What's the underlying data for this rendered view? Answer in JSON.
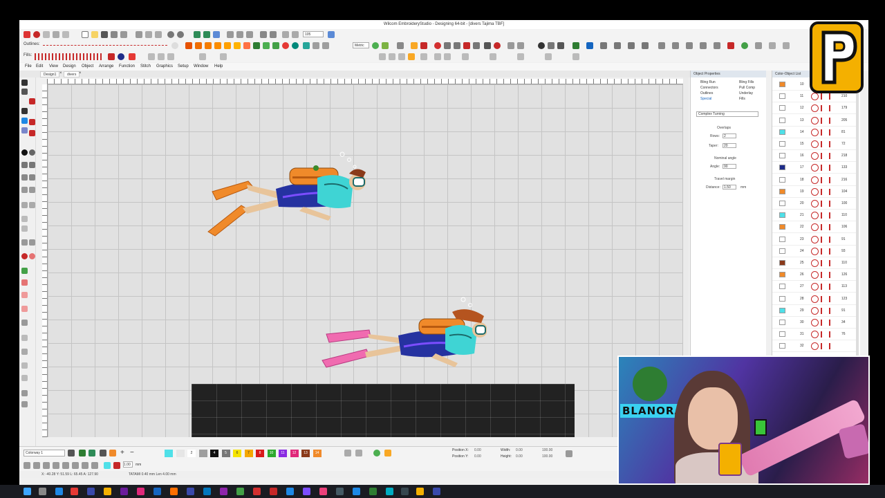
{
  "window": {
    "title": "Wilcom EmbroideryStudio - Designing 64-bit - [divers      Tajima TBF]"
  },
  "toolbar": {
    "outlines_label": "Outlines:",
    "fills_label": "Fills:",
    "zoom_value": "105",
    "units_value": "Metric"
  },
  "menu": [
    "File",
    "Edit",
    "View",
    "Design",
    "Object",
    "Arrange",
    "Function",
    "Stitch",
    "Graphics",
    "Setup",
    "Window",
    "Help"
  ],
  "doc_tabs": [
    "Design1",
    "divers"
  ],
  "object_properties": {
    "title": "Object Properties",
    "tabs": [
      "Bling Run",
      "Bling Fills",
      "Connectors",
      "Pull Comp",
      "Outlines",
      "Underlay",
      "Special",
      "Fills"
    ],
    "stitch_type": "Complex Turning",
    "overlaps_label": "Overlaps",
    "rows_label": "Rows:",
    "rows_value": "2",
    "taper_label": "Taper:",
    "taper_value": "20",
    "nominal_angle_label": "Nominal angle",
    "angle_label": "Angle:",
    "angle_value": "90",
    "travel_margin_label": "Travel margin",
    "distance_label": "Distance:",
    "distance_value": "1.50",
    "distance_unit": "mm"
  },
  "color_object_list": {
    "title": "Color-Object List",
    "rows": [
      {
        "num": "10",
        "count": "",
        "color": "#f08a2a"
      },
      {
        "num": "11",
        "count": "210",
        "color": "#ffffff"
      },
      {
        "num": "12",
        "count": "179",
        "color": "#ffffff"
      },
      {
        "num": "13",
        "count": "205",
        "color": "#ffffff"
      },
      {
        "num": "14",
        "count": "81",
        "color": "#4fe0e8"
      },
      {
        "num": "15",
        "count": "72",
        "color": "#ffffff"
      },
      {
        "num": "16",
        "count": "218",
        "color": "#ffffff"
      },
      {
        "num": "17",
        "count": "133",
        "color": "#1e2c8a"
      },
      {
        "num": "18",
        "count": "216",
        "color": "#ffffff"
      },
      {
        "num": "19",
        "count": "104",
        "color": "#f08a2a"
      },
      {
        "num": "20",
        "count": "100",
        "color": "#ffffff"
      },
      {
        "num": "21",
        "count": "110",
        "color": "#4fe0e8"
      },
      {
        "num": "22",
        "count": "106",
        "color": "#f08a2a"
      },
      {
        "num": "23",
        "count": "91",
        "color": "#ffffff"
      },
      {
        "num": "24",
        "count": "93",
        "color": "#ffffff"
      },
      {
        "num": "25",
        "count": "110",
        "color": "#8a3a1a"
      },
      {
        "num": "26",
        "count": "126",
        "color": "#f08a2a"
      },
      {
        "num": "27",
        "count": "113",
        "color": "#ffffff"
      },
      {
        "num": "28",
        "count": "123",
        "color": "#ffffff"
      },
      {
        "num": "29",
        "count": "91",
        "color": "#4fe0e8"
      },
      {
        "num": "30",
        "count": "34",
        "color": "#ffffff"
      },
      {
        "num": "31",
        "count": "76",
        "color": "#ffffff"
      },
      {
        "num": "32",
        "count": "",
        "color": "#ffffff"
      }
    ]
  },
  "bottom": {
    "colorway": "Colorway 1",
    "palette": [
      {
        "num": "",
        "color": "#4fe0e8"
      },
      {
        "num": "",
        "color": "#e6e6e6"
      },
      {
        "num": "2",
        "color": "#ffffff"
      },
      {
        "num": "",
        "color": "#9e9e9e"
      },
      {
        "num": "4",
        "color": "#111111"
      },
      {
        "num": "5",
        "color": "#777777"
      },
      {
        "num": "6",
        "color": "#f5e300"
      },
      {
        "num": "7",
        "color": "#f5a800"
      },
      {
        "num": "8",
        "color": "#d81b1b"
      },
      {
        "num": "10",
        "color": "#2eaa2e"
      },
      {
        "num": "11",
        "color": "#8a2be2"
      },
      {
        "num": "12",
        "color": "#e0287a"
      },
      {
        "num": "13",
        "color": "#8a3a1a"
      },
      {
        "num": "14",
        "color": "#f08a2a"
      }
    ],
    "position_x_label": "Position X:",
    "position_x_value": "0.00",
    "position_y_label": "Position Y:",
    "position_y_value": "0.00",
    "width_label": "Width:",
    "width_value": "0.00",
    "height_label": "Height:",
    "height_value": "0.00",
    "scale_x": "100.00",
    "scale_y": "100.00",
    "stitch_length_value": "1.00",
    "stitch_length_unit": "mm"
  },
  "status": {
    "left": "X: -40.28  Y: 51.59  L: 65.45  A: 127.90",
    "right": "TATAMI  0.40 mm  Len 4.00 mm"
  },
  "webcam": {
    "sign_text": "BLANORA"
  },
  "colors": {
    "accent_orange": "#f08a2a",
    "accent_cyan": "#4fe0e8",
    "accent_navy": "#1e2c8a",
    "accent_pink": "#f06bb0",
    "logo_yellow": "#f4b000"
  }
}
